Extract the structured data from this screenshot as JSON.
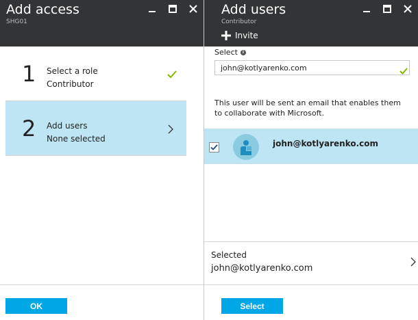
{
  "left_blade": {
    "title": "Add access",
    "subtitle": "SHG01",
    "steps": [
      {
        "number": "1",
        "title": "Select a role",
        "value": "Contributor",
        "status_icon": "checkmark-icon"
      },
      {
        "number": "2",
        "title": "Add users",
        "value": "None selected",
        "status_icon": "chevron-right-icon"
      }
    ],
    "ok_label": "OK"
  },
  "right_blade": {
    "title": "Add users",
    "subtitle": "Contributor",
    "invite_label": "Invite",
    "select_label": "Select",
    "select_value": "john@kotlyarenko.com",
    "info_text": "This user will be sent an email that enables them to collaborate with Microsoft.",
    "results": [
      {
        "email": "john@kotlyarenko.com",
        "checked": true
      }
    ],
    "selected_label": "Selected",
    "selected_value": "john@kotlyarenko.com",
    "select_button_label": "Select"
  },
  "colors": {
    "header_bg": "#333435",
    "accent": "#00a7e7",
    "highlight": "#bde5f3",
    "check_green": "#7fba00"
  }
}
